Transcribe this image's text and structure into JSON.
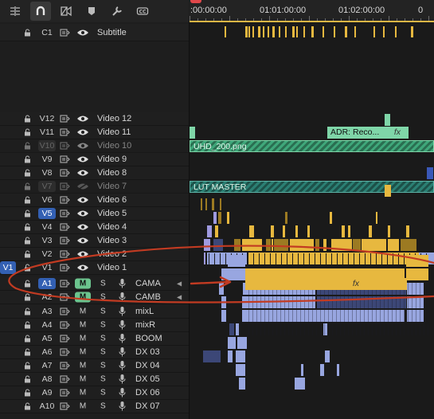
{
  "toolbar": {
    "tools": [
      {
        "icon": "insert-edit-icon"
      },
      {
        "icon": "snap-magnet-icon"
      },
      {
        "icon": "linked-selection-icon"
      },
      {
        "icon": "add-marker-icon"
      },
      {
        "icon": "timeline-settings-wrench-icon"
      },
      {
        "icon": "captions-cc-icon"
      }
    ]
  },
  "ruler": {
    "timecodes": [
      ":00:00:00",
      "01:01:00:00",
      "01:02:00:00",
      "0"
    ]
  },
  "subtitle_track": {
    "name": "C1",
    "label": "Subtitle"
  },
  "video_tracks": [
    {
      "name": "V12",
      "label": "Video 12"
    },
    {
      "name": "V11",
      "label": "Video 11"
    },
    {
      "name": "V10",
      "label": "Video 10"
    },
    {
      "name": "V9",
      "label": "Video 9"
    },
    {
      "name": "V8",
      "label": "Video 8"
    },
    {
      "name": "V7",
      "label": "Video 7"
    },
    {
      "name": "V6",
      "label": "Video 6"
    },
    {
      "name": "V5",
      "label": "Video 5"
    },
    {
      "name": "V4",
      "label": "Video 4"
    },
    {
      "name": "V3",
      "label": "Video 3"
    },
    {
      "name": "V2",
      "label": "Video 2"
    },
    {
      "name": "V1",
      "label": "Video 1",
      "source_patch": "V1"
    }
  ],
  "audio_tracks": [
    {
      "name": "A1",
      "label": "CAMA",
      "mute": "M",
      "solo": "S"
    },
    {
      "name": "A2",
      "label": "CAMB",
      "mute": "M",
      "solo": "S"
    },
    {
      "name": "A3",
      "label": "mixL",
      "mute": "M",
      "solo": "S"
    },
    {
      "name": "A4",
      "label": "mixR",
      "mute": "M",
      "solo": "S"
    },
    {
      "name": "A5",
      "label": "BOOM",
      "mute": "M",
      "solo": "S"
    },
    {
      "name": "A6",
      "label": "DX 03",
      "mute": "M",
      "solo": "S"
    },
    {
      "name": "A7",
      "label": "DX 04",
      "mute": "M",
      "solo": "S"
    },
    {
      "name": "A8",
      "label": "DX 05",
      "mute": "M",
      "solo": "S"
    },
    {
      "name": "A9",
      "label": "DX 06",
      "mute": "M",
      "solo": "S"
    },
    {
      "name": "A10",
      "label": "DX 07",
      "mute": "M",
      "solo": "S"
    }
  ],
  "clips": {
    "v11_adr": "ADR: Reco...",
    "v11_fx": "fx",
    "v10_png": "UHD_200.png",
    "v7_lut": "LUT MASTER",
    "a1_fx": "fx"
  },
  "colors": {
    "selected_track": "#3360b3",
    "mute_on": "#6cc48e",
    "video_clip": "#e7b83f",
    "audio_clip": "#98a6e0",
    "adjustment_clip": "#7fd6a8",
    "playhead": "#e0474a",
    "annotation": "#c23b22"
  }
}
